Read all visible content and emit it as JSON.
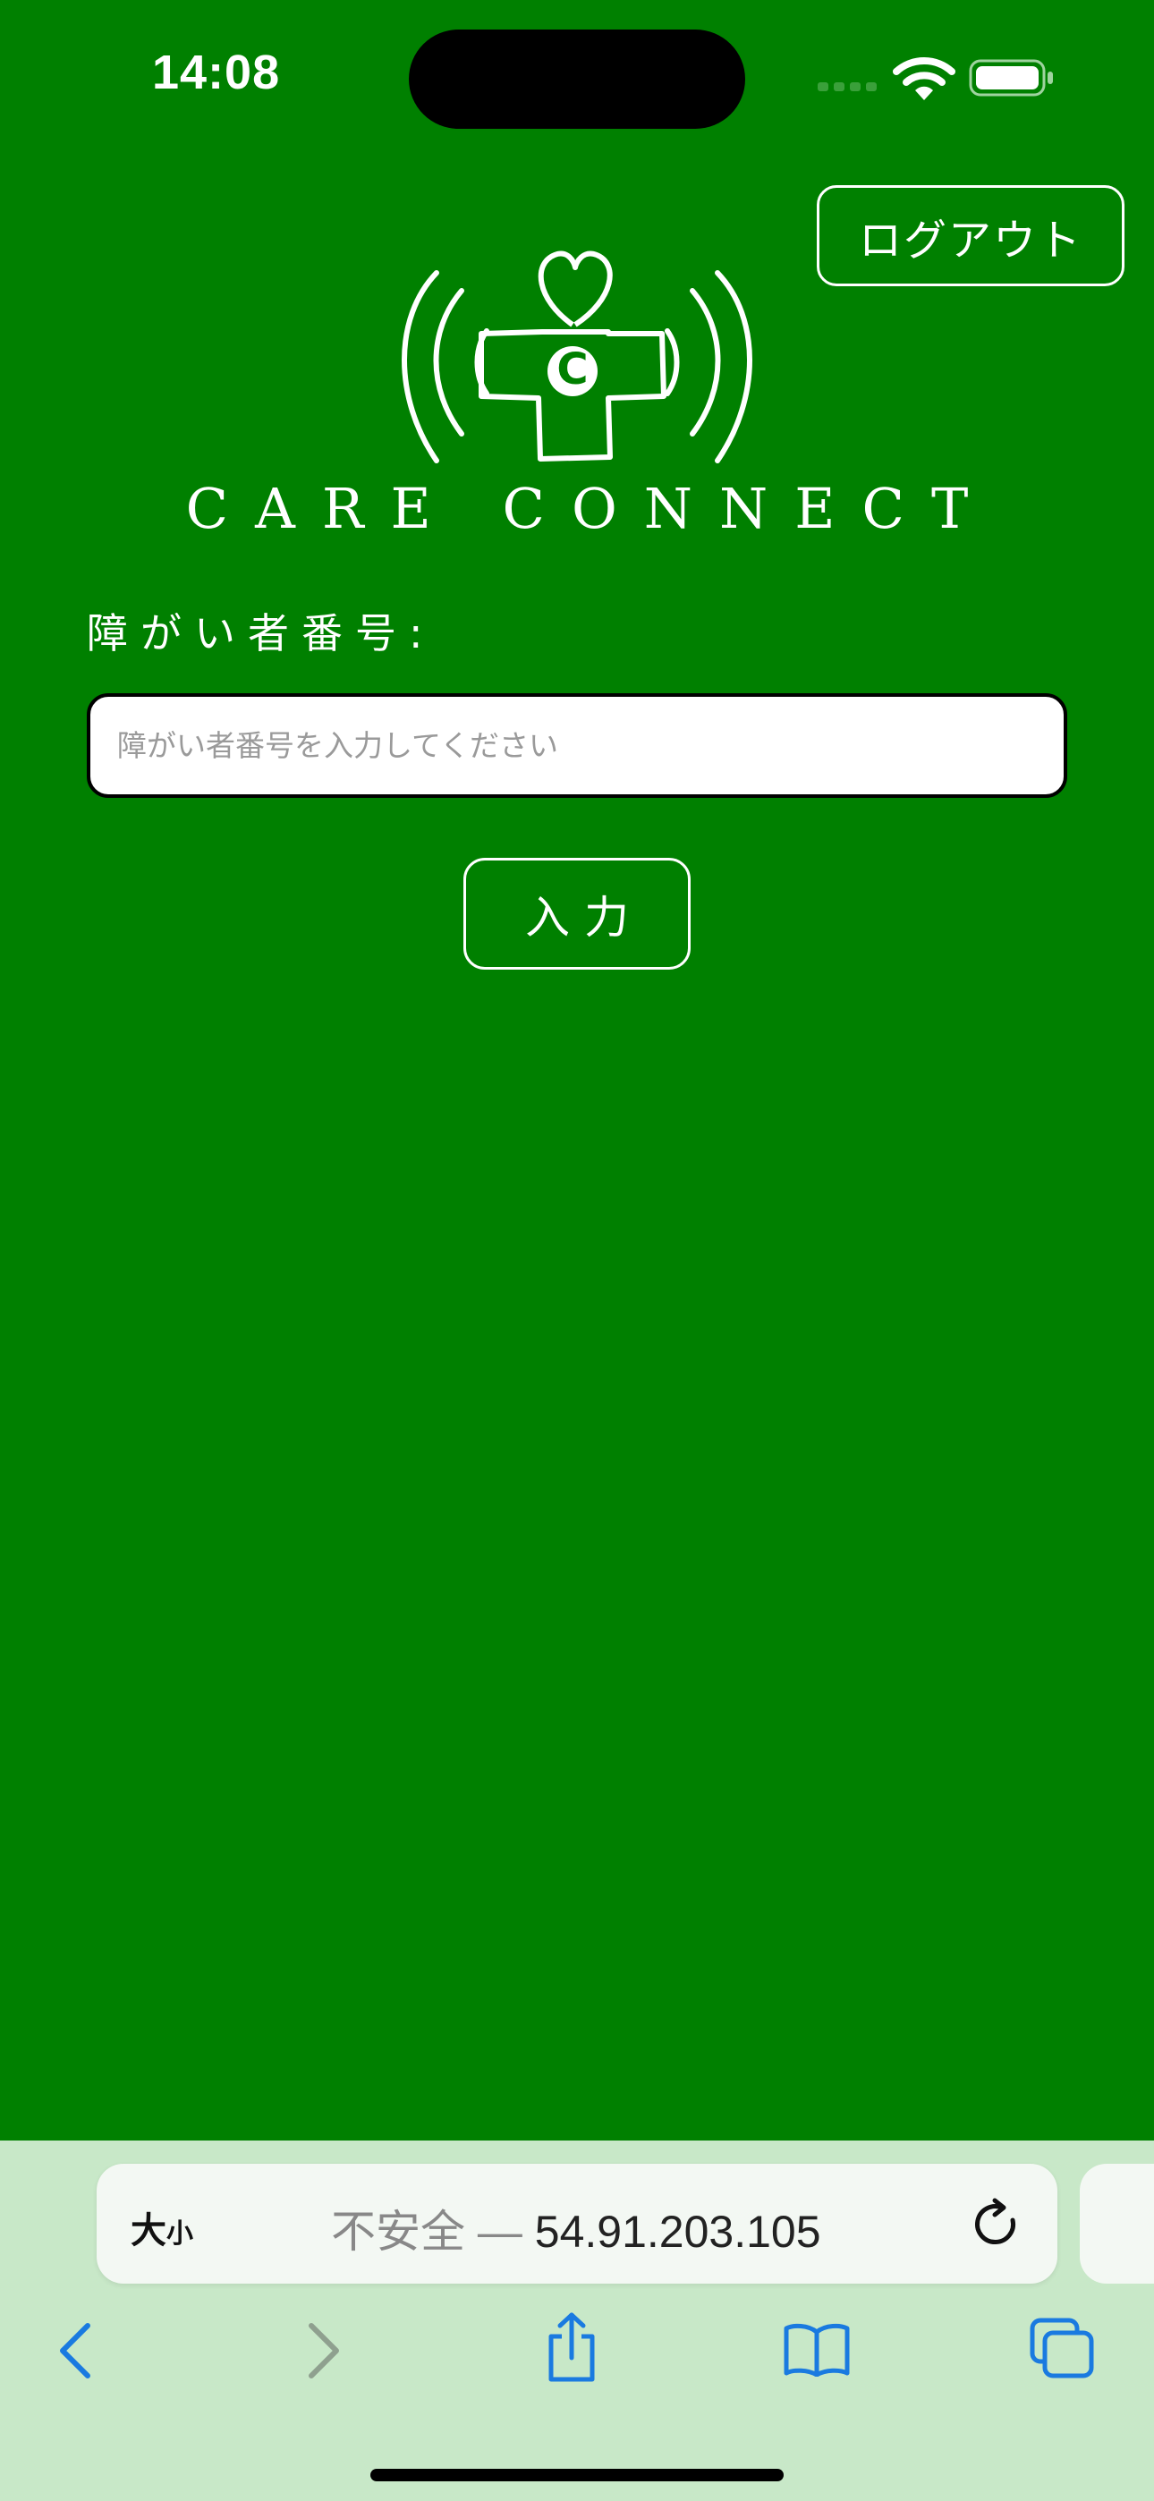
{
  "status_bar": {
    "time": "14:08"
  },
  "header": {
    "logout_label": "ログアウト"
  },
  "logo": {
    "badge_letter": "C",
    "brand_name": "CARE CONNECT"
  },
  "form": {
    "label": "障がい者番号:",
    "input_value": "",
    "input_placeholder": "障がい者番号を入力してください",
    "submit_label": "入力"
  },
  "browser": {
    "text_size_large": "大",
    "text_size_small": "小",
    "url_prefix": "不安全 — ",
    "url_host": "54.91.203.105"
  },
  "colors": {
    "background": "#008000",
    "browser_chrome": "#c8e8c8",
    "accent_blue": "#1a7ae0"
  }
}
